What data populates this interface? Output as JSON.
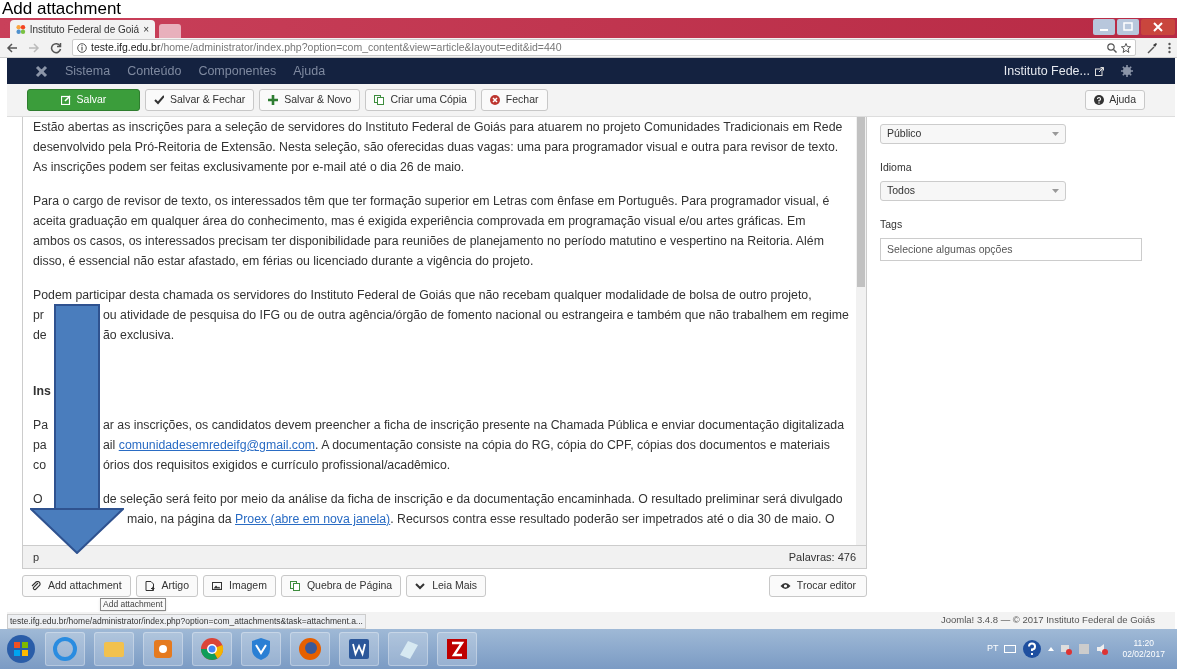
{
  "caption": "Add attachment",
  "browser": {
    "tab_title": "Instituto Federal de Goiá",
    "tab_close": "×",
    "url_host": "teste.ifg.edu.br",
    "url_path": "/home/administrator/index.php?option=com_content&view=article&layout=edit&id=440"
  },
  "admin_menu": {
    "items": [
      "Sistema",
      "Conteúdo",
      "Componentes",
      "Ajuda"
    ],
    "site_link": "Instituto Fede..."
  },
  "toolbar": {
    "buttons": [
      {
        "label": "Salvar",
        "kind": "primary"
      },
      {
        "label": "Salvar & Fechar",
        "kind": "check"
      },
      {
        "label": "Salvar & Novo",
        "kind": "plus"
      },
      {
        "label": "Criar uma Cópia",
        "kind": "copy"
      },
      {
        "label": "Fechar",
        "kind": "close"
      }
    ],
    "help": "Ajuda"
  },
  "editor": {
    "paragraphs": [
      {
        "kind": "paragraph",
        "lines": [
          [
            {
              "kind": "text",
              "text": "Estão abertas as inscrições para a seleção de servidores do Instituto Federal de Goiás para atuarem no projeto Comunidades Tradicionais em Rede"
            }
          ],
          [
            {
              "kind": "text",
              "text": "desenvolvido pela Pró-Reitoria de Extensão. Nesta seleção, são oferecidas duas vagas: uma para programador visual e outra para revisor de texto."
            }
          ],
          [
            {
              "kind": "text",
              "text": "As inscrições podem ser feitas exclusivamente por e-mail até o dia 26 de maio."
            }
          ]
        ]
      },
      {
        "kind": "paragraph",
        "lines": [
          [
            {
              "kind": "text",
              "text": "Para o cargo de revisor de texto, os interessados têm que ter formação superior em Letras com ênfase em Português. Para programador visual, é"
            }
          ],
          [
            {
              "kind": "text",
              "text": "aceita graduação em qualquer área do conhecimento, mas é exigida experiência comprovada em programação visual e/ou artes gráficas. Em"
            }
          ],
          [
            {
              "kind": "text",
              "text": "ambos os casos, os interessados precisam ter disponibilidade para reuniões de planejamento no período matutino e vespertino na Reitoria. Além"
            }
          ],
          [
            {
              "kind": "text",
              "text": "disso, é essencial não estar afastado, em férias ou licenciado durante a vigência do projeto."
            }
          ]
        ]
      },
      {
        "kind": "paragraph",
        "lines": [
          [
            {
              "kind": "text",
              "text": "Podem participar desta chamada os servidores do Instituto Federal de Goiás que não recebam qualquer modalidade de bolsa de outro projeto,"
            }
          ],
          [
            {
              "kind": "text",
              "text": "pr"
            },
            {
              "kind": "gap"
            },
            {
              "kind": "text",
              "text": "ou atividade de pesquisa do IFG ou de outra agência/órgão de fomento nacional ou estrangeira e também que não trabalhem em regime"
            }
          ],
          [
            {
              "kind": "text",
              "text": "de"
            },
            {
              "kind": "gap"
            },
            {
              "kind": "text",
              "text": "ão exclusiva."
            }
          ]
        ]
      },
      {
        "kind": "heading",
        "lines": [
          [
            {
              "kind": "text",
              "text": "Ins"
            }
          ]
        ]
      },
      {
        "kind": "paragraph",
        "lines": [
          [
            {
              "kind": "text",
              "text": "Pa"
            },
            {
              "kind": "gap"
            },
            {
              "kind": "text",
              "text": "ar as inscrições, os candidatos devem preencher a ficha de inscrição presente na Chamada Pública e enviar documentação digitalizada"
            }
          ],
          [
            {
              "kind": "text",
              "text": "pa"
            },
            {
              "kind": "gap"
            },
            {
              "kind": "text",
              "text": "ail "
            },
            {
              "kind": "link",
              "text": "comunidadesemredeifg@gmail.com"
            },
            {
              "kind": "text",
              "text": ". A documentação consiste na cópia do RG, cópia do CPF, cópias dos documentos e materiais"
            }
          ],
          [
            {
              "kind": "text",
              "text": "co"
            },
            {
              "kind": "gap"
            },
            {
              "kind": "text",
              "text": "órios dos requisitos exigidos e currículo profissional/acadêmico."
            }
          ]
        ]
      },
      {
        "kind": "paragraph",
        "lines": [
          [
            {
              "kind": "text",
              "text": "O"
            },
            {
              "kind": "gap"
            },
            {
              "kind": "text",
              "text": "de seleção será feito por meio da análise da ficha de inscrição e da documentação encaminhada. O resultado preliminar será divulgado"
            }
          ],
          [
            {
              "kind": "gap"
            },
            {
              "kind": "text",
              "text": "maio, na página da "
            },
            {
              "kind": "link",
              "text": "Proex (abre em nova janela)"
            },
            {
              "kind": "text",
              "text": ". Recursos contra esse resultado poderão ser impetrados até o dia 30 de maio. O"
            }
          ]
        ]
      }
    ],
    "path": "p",
    "word_count": "Palavras: 476"
  },
  "editor_buttons": [
    {
      "label": "Add attachment",
      "kind": "clip"
    },
    {
      "label": "Artigo",
      "kind": "article"
    },
    {
      "label": "Imagem",
      "kind": "image"
    },
    {
      "label": "Quebra de Página",
      "kind": "copy"
    },
    {
      "label": "Leia Mais",
      "kind": "chevron"
    }
  ],
  "toggle_editor": "Trocar editor",
  "tooltip": "Add attachment",
  "sidebar": {
    "fields": [
      {
        "kind": "select",
        "value": "Público"
      },
      {
        "kind": "select",
        "label": "Idioma",
        "value": "Todos"
      },
      {
        "kind": "input",
        "label": "Tags",
        "placeholder": "Selecione algumas opções"
      }
    ]
  },
  "status_url": "teste.ifg.edu.br/home/administrator/index.php?option=com_attachments&task=attachment.a...",
  "footer": "Joomla! 3.4.8 — © 2017 Instituto Federal de Goiás",
  "taskbar": {
    "language": "PT",
    "time": "11:20",
    "date": "02/02/2017"
  }
}
